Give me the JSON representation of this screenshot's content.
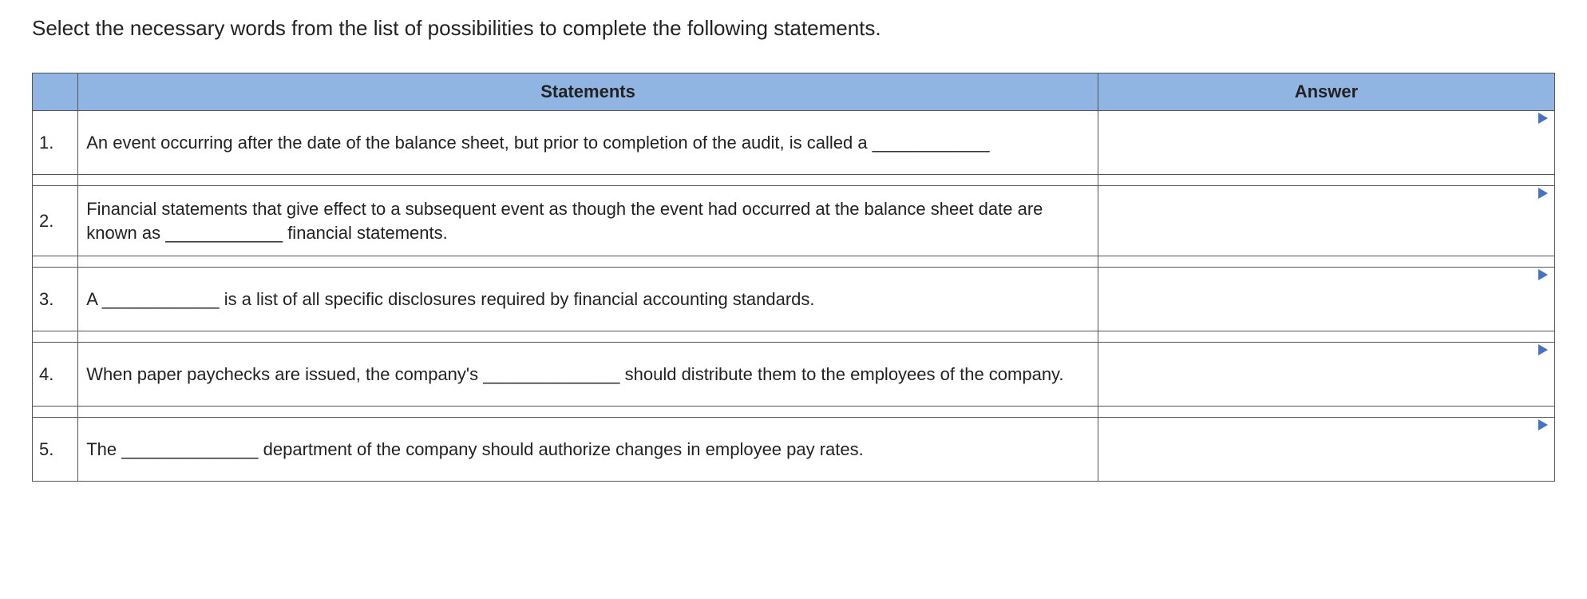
{
  "instructions": "Select the necessary words from the list of possibilities to complete the following statements.",
  "headers": {
    "statements": "Statements",
    "answer": "Answer"
  },
  "rows": [
    {
      "num": "1.",
      "statement": "An event occurring after the date of the balance sheet, but prior to completion of the audit, is called a ____________"
    },
    {
      "num": "2.",
      "statement": "Financial statements that give effect to a subsequent event as though the event had occurred at the balance sheet date are known as ____________ financial statements."
    },
    {
      "num": "3.",
      "statement": "A ____________ is a list of all specific disclosures required by financial accounting standards."
    },
    {
      "num": "4.",
      "statement": "When paper paychecks are issued, the company's ______________ should distribute them to the employees of the company."
    },
    {
      "num": "5.",
      "statement": "The ______________ department of the company should authorize changes in employee pay rates."
    }
  ]
}
